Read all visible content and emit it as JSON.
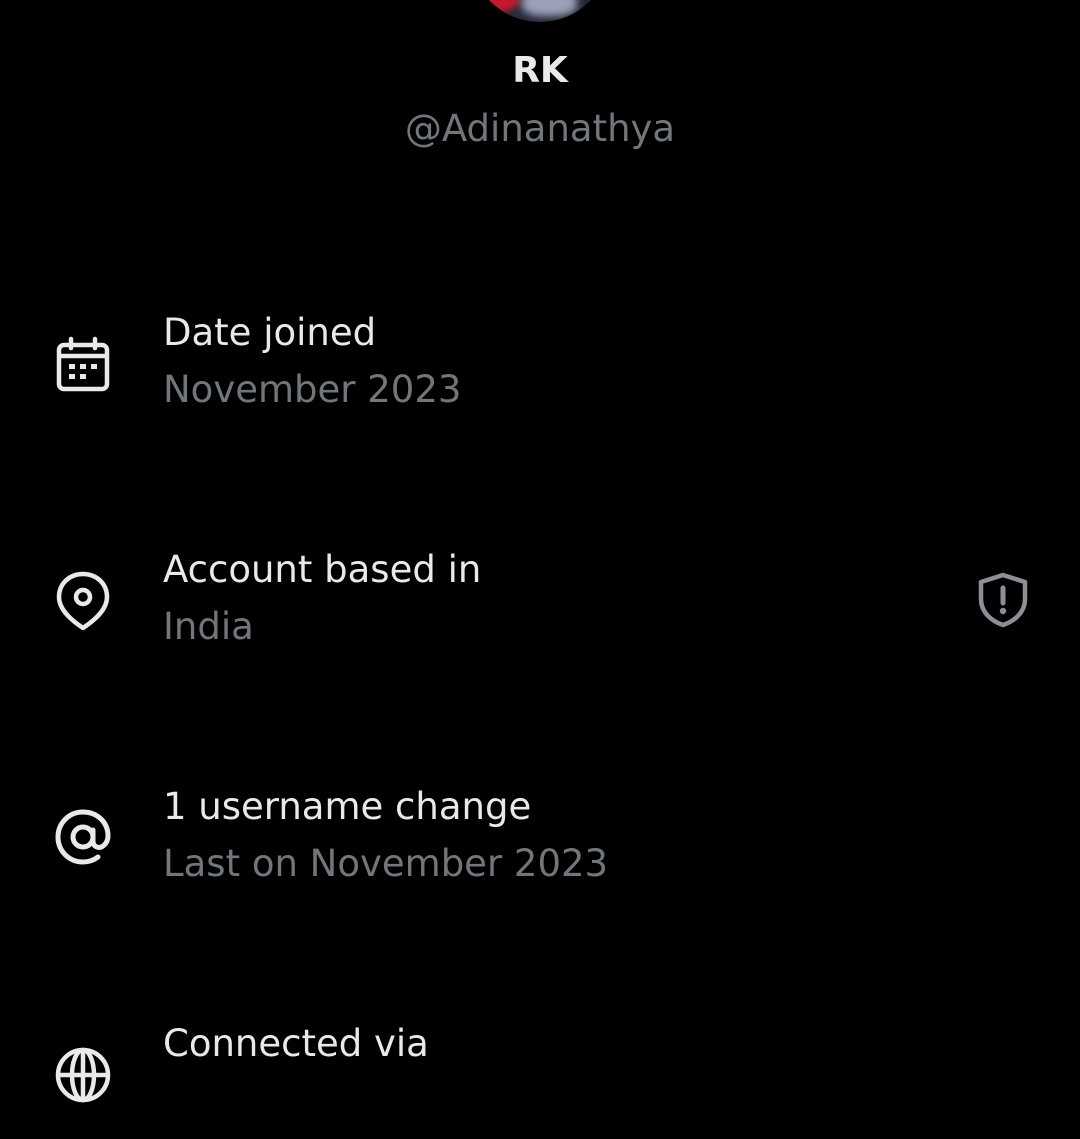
{
  "profile": {
    "display_name": "RK",
    "handle": "@Adinanathya"
  },
  "rows": [
    {
      "icon": "calendar-icon",
      "title": "Date joined",
      "subtitle": "November 2023"
    },
    {
      "icon": "location-pin-icon",
      "title": "Account based in",
      "subtitle": "India",
      "trailing_icon": "shield-alert-icon"
    },
    {
      "icon": "at-sign-icon",
      "title": "1 username change",
      "subtitle": "Last on November 2023"
    },
    {
      "icon": "globe-icon",
      "title": "Connected via"
    }
  ],
  "colors": {
    "background": "#000000",
    "primary_text": "#e7e9ea",
    "secondary_text": "#71767b"
  }
}
